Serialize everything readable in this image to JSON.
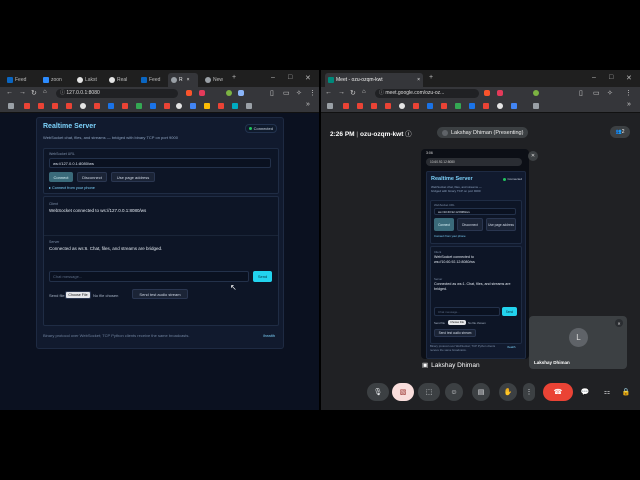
{
  "colors": {
    "accent": "#22d3ee",
    "title": "#7dd3fc",
    "connected": "#22c55e",
    "end_call": "#ea4335",
    "cam_off": "#f9dedc"
  },
  "left_browser": {
    "tabs": [
      {
        "label": "Feed",
        "icon": "linkedin-icon",
        "color": "#0a66c2"
      },
      {
        "label": "zoon",
        "icon": "zoom-icon",
        "color": "#2d8cff"
      },
      {
        "label": "Lakst",
        "icon": "github-icon",
        "color": "#e5e5e5"
      },
      {
        "label": "Real",
        "icon": "github-icon",
        "color": "#e5e5e5"
      },
      {
        "label": "Feed",
        "icon": "linkedin-icon",
        "color": "#0a66c2"
      },
      {
        "label": "R",
        "icon": "globe-icon",
        "color": "#9aa0a6"
      },
      {
        "label": "New",
        "icon": "chrome-icon",
        "color": "#9aa0a6"
      }
    ],
    "url": "127.0.0.1:8080"
  },
  "app": {
    "title": "Realtime Server",
    "subtitle": "WebSocket chat, files, and streams — bridged with binary TCP on port 9000",
    "status": "Connected",
    "ws_label": "WebSocket URL",
    "ws_value": "ws://127.0.0.1:8080/ws",
    "connect": "Connect",
    "disconnect": "Disconnect",
    "use_page": "Use page address",
    "phone_hint": "Connect from your phone",
    "messages": [
      {
        "label": "Client",
        "text": "WebSocket connected to ws://127.0.0.1:8080/ws"
      },
      {
        "label": "Server",
        "text": "Connected as ws:6. Chat, files, and streams are bridged."
      }
    ],
    "chat_placeholder": "Chat message...",
    "send": "Send",
    "send_file_label": "Send file",
    "choose_file": "Choose File",
    "no_file": "No file chosen",
    "audio_btn": "Send test audio stream",
    "footer": "Binary protocol over WebSocket; TCP Python clients receive the same broadcasts.",
    "health": "/health"
  },
  "right_browser": {
    "tab_label": "Meet - ozu-ozqm-kwt",
    "url": "meet.google.com/ozu-oz..."
  },
  "meet": {
    "time": "2:26 PM",
    "code": "ozu-ozqm-kwt",
    "presenter": "Lakshay Dhiman (Presenting)",
    "people_count": "2",
    "pinned_name": "Lakshay Dhiman",
    "self_name": "Lakshay Dhiman",
    "self_initial": "L"
  },
  "phone": {
    "time": "3:06",
    "url": "10.60.92.12:8080",
    "title": "Realtime Server",
    "subtitle": "WebSocket chat, files, and streams — bridged with binary TCP on port 9000",
    "status": "Connected",
    "ws_label": "WebSocket URL",
    "ws_value": "ws://10.60.92.12:8080/ws",
    "connect": "Connect",
    "disconnect": "Disconnect",
    "use_page": "Use page address",
    "phone_hint": "Connect from your phone",
    "client_label": "Client",
    "client_text": "WebSocket connected to ws://10.60.92.12:8080/ws",
    "server_label": "Server",
    "server_text": "Connected as ws:1. Chat, files, and streams are bridged.",
    "chat_placeholder": "Chat message...",
    "send": "Send",
    "send_file": "Send file",
    "choose_file": "Choose File",
    "no_file": "No file chosen",
    "audio_btn": "Send test audio stream",
    "footer": "Binary protocol over WebSocket; TCP Python clients receive the same broadcasts.",
    "health": "/health"
  }
}
